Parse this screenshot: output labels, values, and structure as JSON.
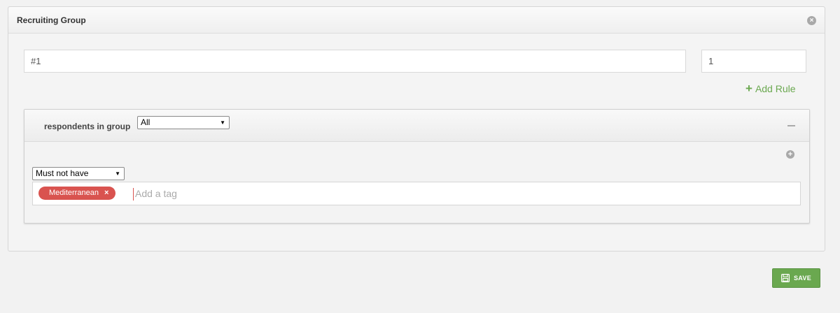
{
  "panel": {
    "title": "Recruiting Group",
    "name_value": "#1",
    "count_value": "1",
    "add_rule_label": "Add Rule"
  },
  "rule": {
    "label": "respondents in group",
    "group_select": "All",
    "condition_select": "Must not have",
    "tags": [
      {
        "label": "Mediterranean"
      }
    ],
    "tag_placeholder": "Add a tag"
  },
  "footer": {
    "save_label": "SAVE"
  },
  "colors": {
    "accent_green": "#6aa84f",
    "tag_red": "#d9534f"
  },
  "icons": {
    "close": "close-icon",
    "add_rule": "plus-icon",
    "collapse": "minus-icon",
    "add_condition": "plus-circle-icon",
    "tag_remove": "x-icon",
    "save": "floppy-disk-icon"
  }
}
